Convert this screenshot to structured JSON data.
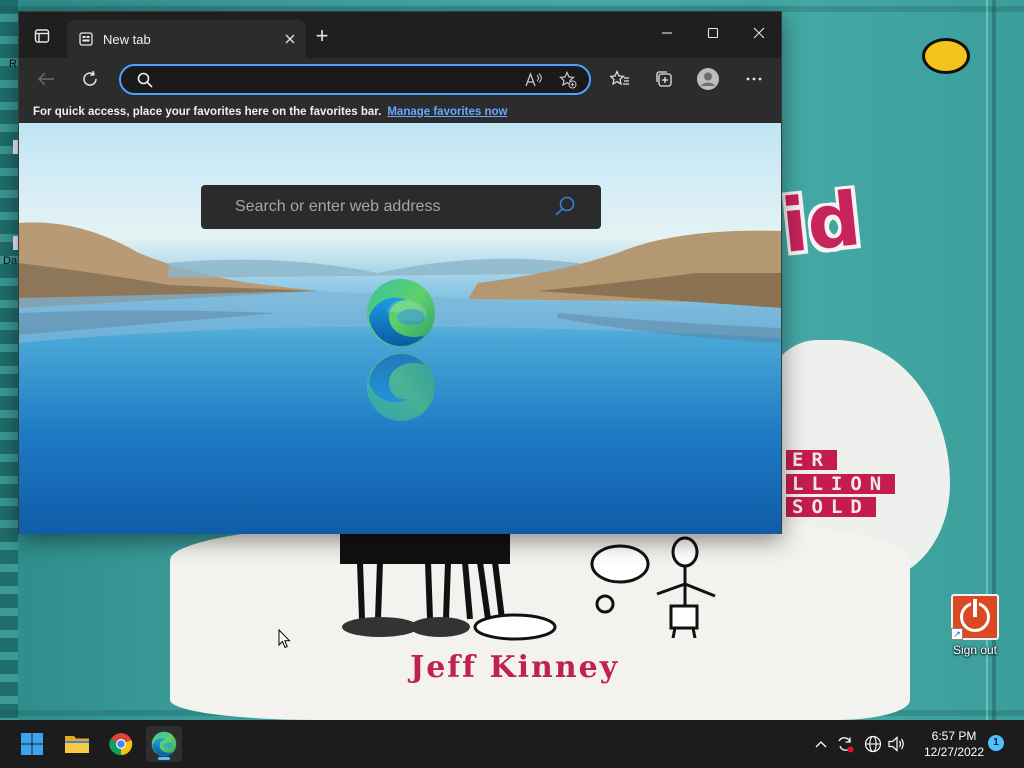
{
  "desktop": {
    "wallpaper": {
      "title_fragment": "id",
      "banner_lines": [
        "ER",
        "LLION",
        "SOLD"
      ],
      "author": "Jeff Kinney"
    },
    "left_fragments": [
      "R",
      "Da"
    ],
    "icons": [
      {
        "label": "Sign out",
        "icon": "power-icon",
        "color": "#d94a24"
      }
    ]
  },
  "browser": {
    "tab": {
      "title": "New tab",
      "icon": "new-tab-page-icon"
    },
    "new_tab_symbol": "+",
    "window_controls": [
      "minimize",
      "maximize",
      "close"
    ],
    "address_bar": {
      "value": "",
      "placeholder": ""
    },
    "toolbar_icons": [
      "back-icon",
      "refresh-icon",
      "read-aloud-icon",
      "add-favorite-icon",
      "favorites-icon",
      "collections-icon",
      "profile-icon",
      "more-icon"
    ],
    "favorites_bar": {
      "message": "For quick access, place your favorites here on the favorites bar.",
      "link": "Manage favorites now"
    },
    "ntp": {
      "search_placeholder": "Search or enter web address"
    }
  },
  "taskbar": {
    "apps": [
      "start",
      "file-explorer",
      "chrome",
      "edge"
    ],
    "active_app": "edge",
    "tray": {
      "time": "6:57 PM",
      "date": "12/27/2022",
      "notification_count": "1"
    }
  },
  "colors": {
    "accent": "#4cc2ff",
    "address_focus": "#4aa3ff",
    "link": "#66a9ff",
    "signout_tile": "#d94a24",
    "wallpaper_red": "#c41c4f"
  }
}
